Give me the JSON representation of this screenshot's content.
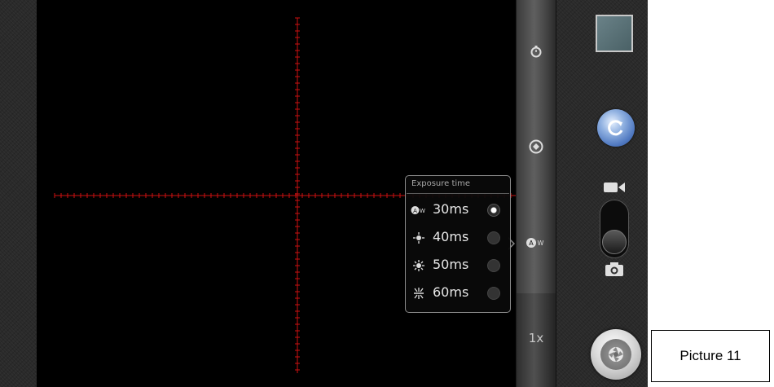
{
  "exposure_popup": {
    "title": "Exposure time",
    "options": [
      {
        "label": "30ms",
        "icon": "auto-white-balance-icon",
        "selected": true
      },
      {
        "label": "40ms",
        "icon": "sun-icon",
        "selected": false
      },
      {
        "label": "50ms",
        "icon": "bright-sun-icon",
        "selected": false
      },
      {
        "label": "60ms",
        "icon": "sun-rays-icon",
        "selected": false
      }
    ]
  },
  "settings_strip": {
    "zoom_label": "1x",
    "icons": [
      "timer-icon",
      "camera-rotate-icon",
      "auto-white-balance-icon"
    ]
  },
  "right_panel": {
    "icons": [
      "thumbnail",
      "switch-camera-icon",
      "video-icon",
      "camera-icon",
      "shutter-icon"
    ]
  },
  "caption": {
    "text": "Picture 11"
  },
  "colors": {
    "reticle": "#cc1111",
    "background": "#000000",
    "popup_border": "#8a8a8a",
    "switch_button": "#4f78c0"
  }
}
